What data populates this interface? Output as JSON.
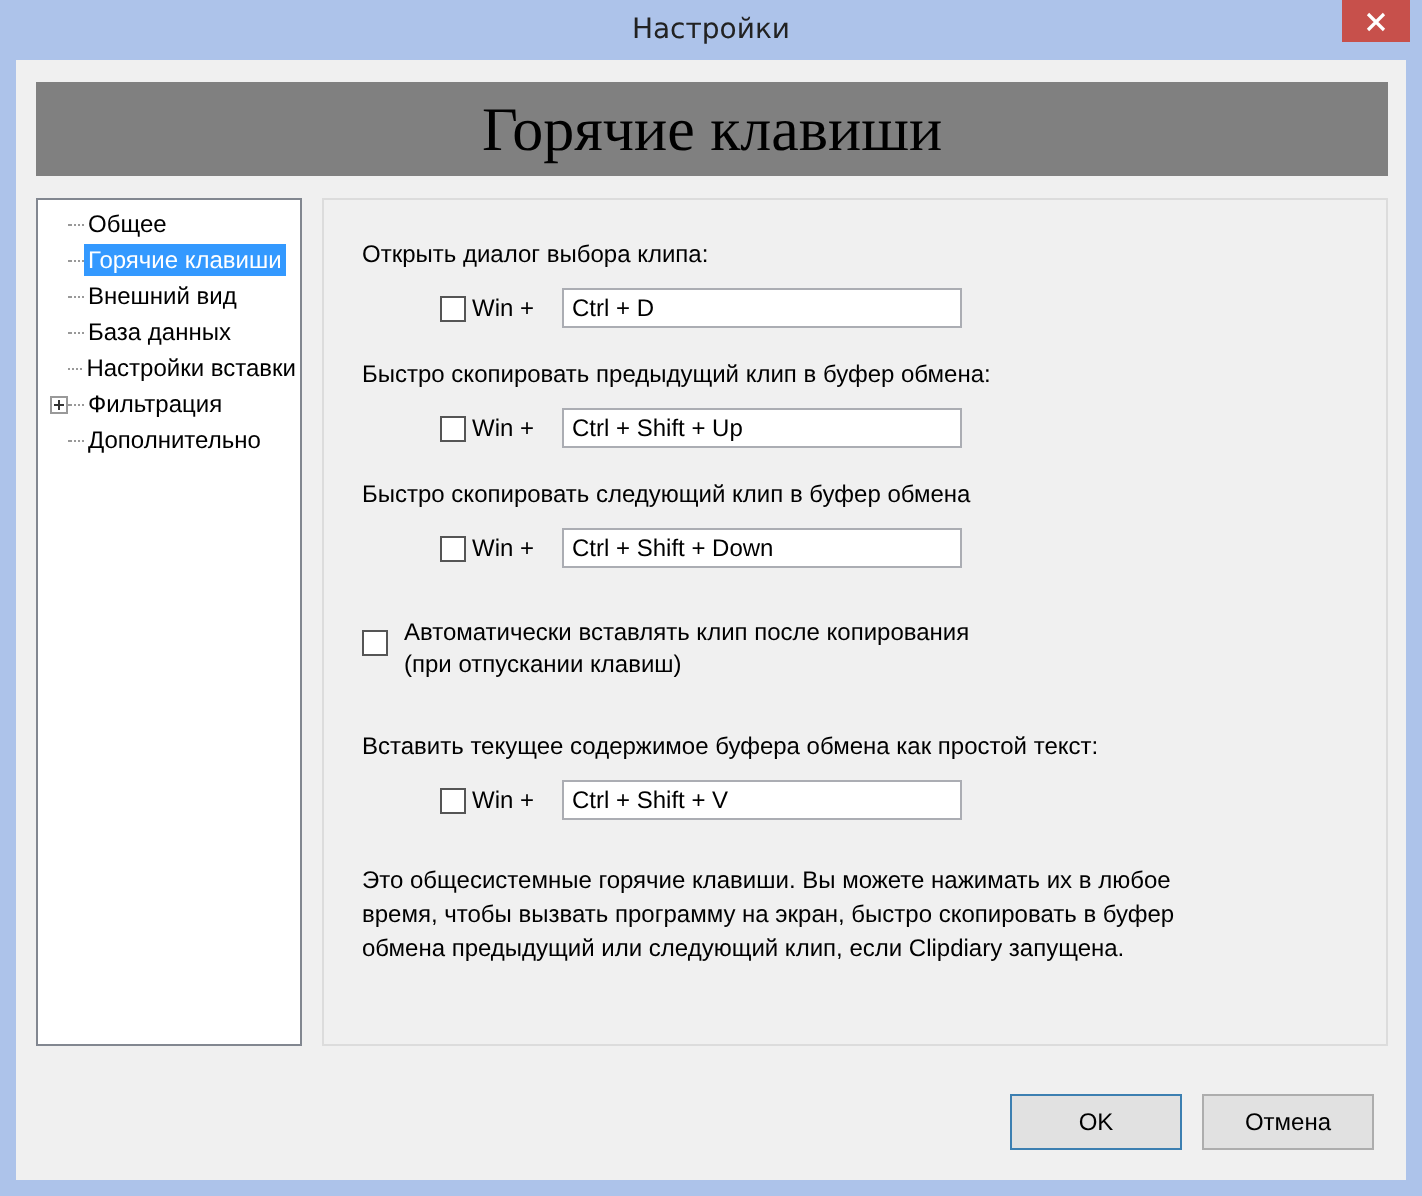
{
  "window": {
    "title": "Настройки"
  },
  "header": "Горячие клавиши",
  "sidebar": {
    "items": [
      {
        "label": "Общее",
        "selected": false,
        "expandable": false
      },
      {
        "label": "Горячие клавиши",
        "selected": true,
        "expandable": false
      },
      {
        "label": "Внешний вид",
        "selected": false,
        "expandable": false
      },
      {
        "label": "База данных",
        "selected": false,
        "expandable": false
      },
      {
        "label": "Настройки вставки",
        "selected": false,
        "expandable": false
      },
      {
        "label": "Фильтрация",
        "selected": false,
        "expandable": true
      },
      {
        "label": "Дополнительно",
        "selected": false,
        "expandable": false
      }
    ]
  },
  "settings": [
    {
      "kind": "hotkey",
      "label": "Открыть диалог выбора клипа:",
      "win_label": "Win +",
      "win_checked": false,
      "value": "Ctrl + D"
    },
    {
      "kind": "hotkey",
      "label": "Быстро скопировать предыдущий клип в буфер обмена:",
      "win_label": "Win +",
      "win_checked": false,
      "value": "Ctrl + Shift + Up"
    },
    {
      "kind": "hotkey",
      "label": "Быстро скопировать следующий клип в буфер обмена",
      "win_label": "Win +",
      "win_checked": false,
      "value": "Ctrl + Shift + Down"
    },
    {
      "kind": "checkbox",
      "label": "Автоматически вставлять клип после копирования\n(при отпускании клавиш)",
      "checked": false
    },
    {
      "kind": "hotkey",
      "label": "Вставить текущее содержимое буфера обмена как простой текст:",
      "win_label": "Win +",
      "win_checked": false,
      "value": "Ctrl + Shift + V"
    }
  ],
  "note": "Это общесистемные горячие клавиши. Вы можете нажимать их в любое время, чтобы вызвать программу на экран, быстро скопировать в буфер обмена предыдущий или следующий клип, если Clipdiary запущена.",
  "buttons": [
    {
      "label": "OK",
      "default": true
    },
    {
      "label": "Отмена",
      "default": false
    }
  ]
}
